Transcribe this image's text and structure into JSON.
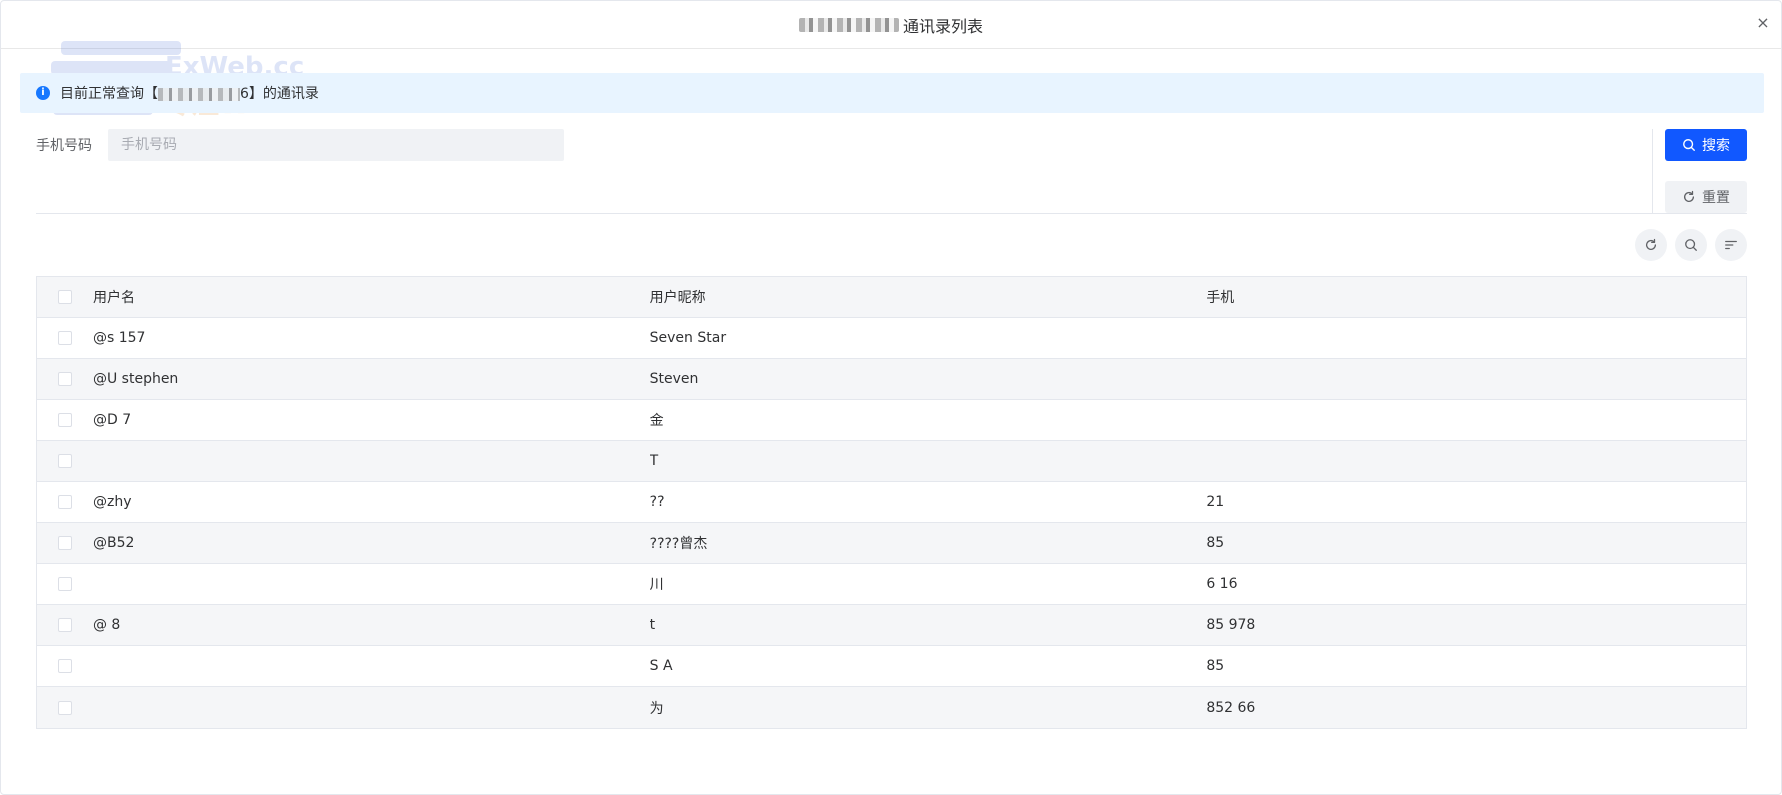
{
  "dialog": {
    "title": "通讯录列表",
    "close_label": "×"
  },
  "watermark": {
    "top": "ExWeb.cc",
    "bottom": "专注WEB"
  },
  "alert": {
    "prefix": "目前正常查询【",
    "suffix": "6】的通讯录"
  },
  "search_form": {
    "phone_label": "手机号码",
    "phone_placeholder": "手机号码",
    "phone_value": ""
  },
  "buttons": {
    "search": "搜索",
    "reset": "重置"
  },
  "toolbar": {
    "icons": [
      "refresh-icon",
      "search-icon",
      "column-filter-icon"
    ]
  },
  "table": {
    "headers": [
      "用户名",
      "用户昵称",
      "手机"
    ],
    "rows": [
      {
        "username": "@s 157",
        "nickname": "Seven Star",
        "phone": ""
      },
      {
        "username": "@U stephen",
        "nickname": "Steven",
        "phone": ""
      },
      {
        "username": "@D 7",
        "nickname": "金",
        "phone": ""
      },
      {
        "username": "",
        "nickname": "T",
        "phone": ""
      },
      {
        "username": "@zhy",
        "nickname": "??",
        "phone": "21"
      },
      {
        "username": "@B52",
        "nickname": "????曾杰",
        "phone": "85"
      },
      {
        "username": "",
        "nickname": "川",
        "phone": "6 16"
      },
      {
        "username": "@ 8",
        "nickname": "t",
        "phone": "85 978"
      },
      {
        "username": "",
        "nickname": "S A",
        "phone": "85"
      },
      {
        "username": "",
        "nickname": "为",
        "phone": "852 66"
      }
    ]
  },
  "colors": {
    "primary": "#1158ff",
    "alert_bg": "#e8f4ff",
    "info_icon": "#1677ff"
  }
}
